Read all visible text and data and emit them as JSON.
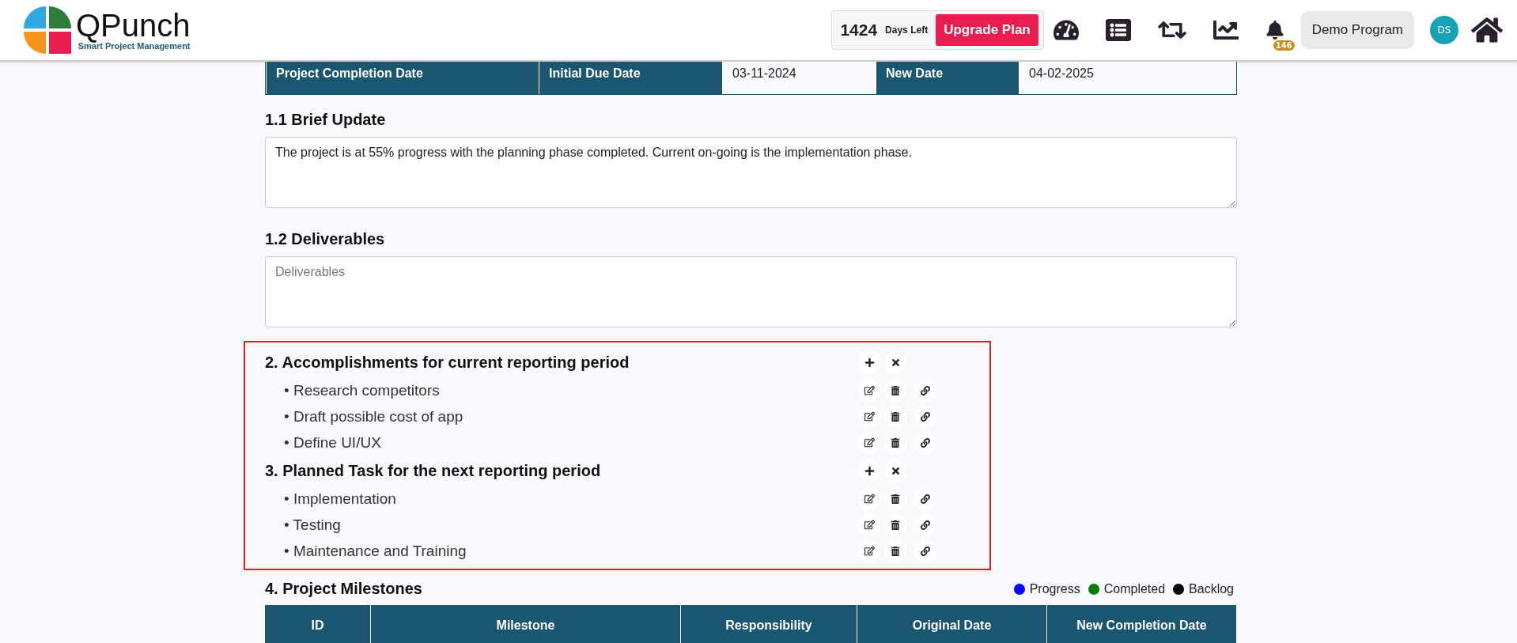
{
  "header": {
    "logo": {
      "name": "QPunch",
      "tagline": "Smart Project Management"
    },
    "days_count": "1424",
    "days_label": "Days Left",
    "upgrade_button": "Upgrade Plan",
    "notification_count": "146",
    "program_button": "Demo Program",
    "avatar": "DS"
  },
  "completion_row": {
    "label": "Project Completion Date",
    "initial_label": "Initial Due Date",
    "initial_value": "03-11-2024",
    "new_label": "New Date",
    "new_value": "04-02-2025"
  },
  "brief_update": {
    "heading": "1.1 Brief Update",
    "value": "The project is at 55% progress with the planning phase completed. Current on-going is the implementation phase."
  },
  "deliverables": {
    "heading": "1.2 Deliverables",
    "placeholder": "Deliverables"
  },
  "task_sections": [
    {
      "heading": "2. Accomplishments for current reporting period",
      "items": [
        "• Research competitors",
        "• Draft possible cost of app",
        "• Define UI/UX"
      ]
    },
    {
      "heading": "3. Planned Task for the next reporting period",
      "items": [
        "• Implementation",
        "• Testing",
        "• Maintenance and Training"
      ]
    }
  ],
  "milestones": {
    "heading": "4. Project Milestones",
    "legend": [
      {
        "label": "Progress",
        "color": "#0000ff"
      },
      {
        "label": "Completed",
        "color": "#0a7a0a"
      },
      {
        "label": "Backlog",
        "color": "#000000"
      }
    ],
    "columns": [
      "ID",
      "Milestone",
      "Responsibility",
      "Original Date",
      "New Completion Date"
    ]
  }
}
